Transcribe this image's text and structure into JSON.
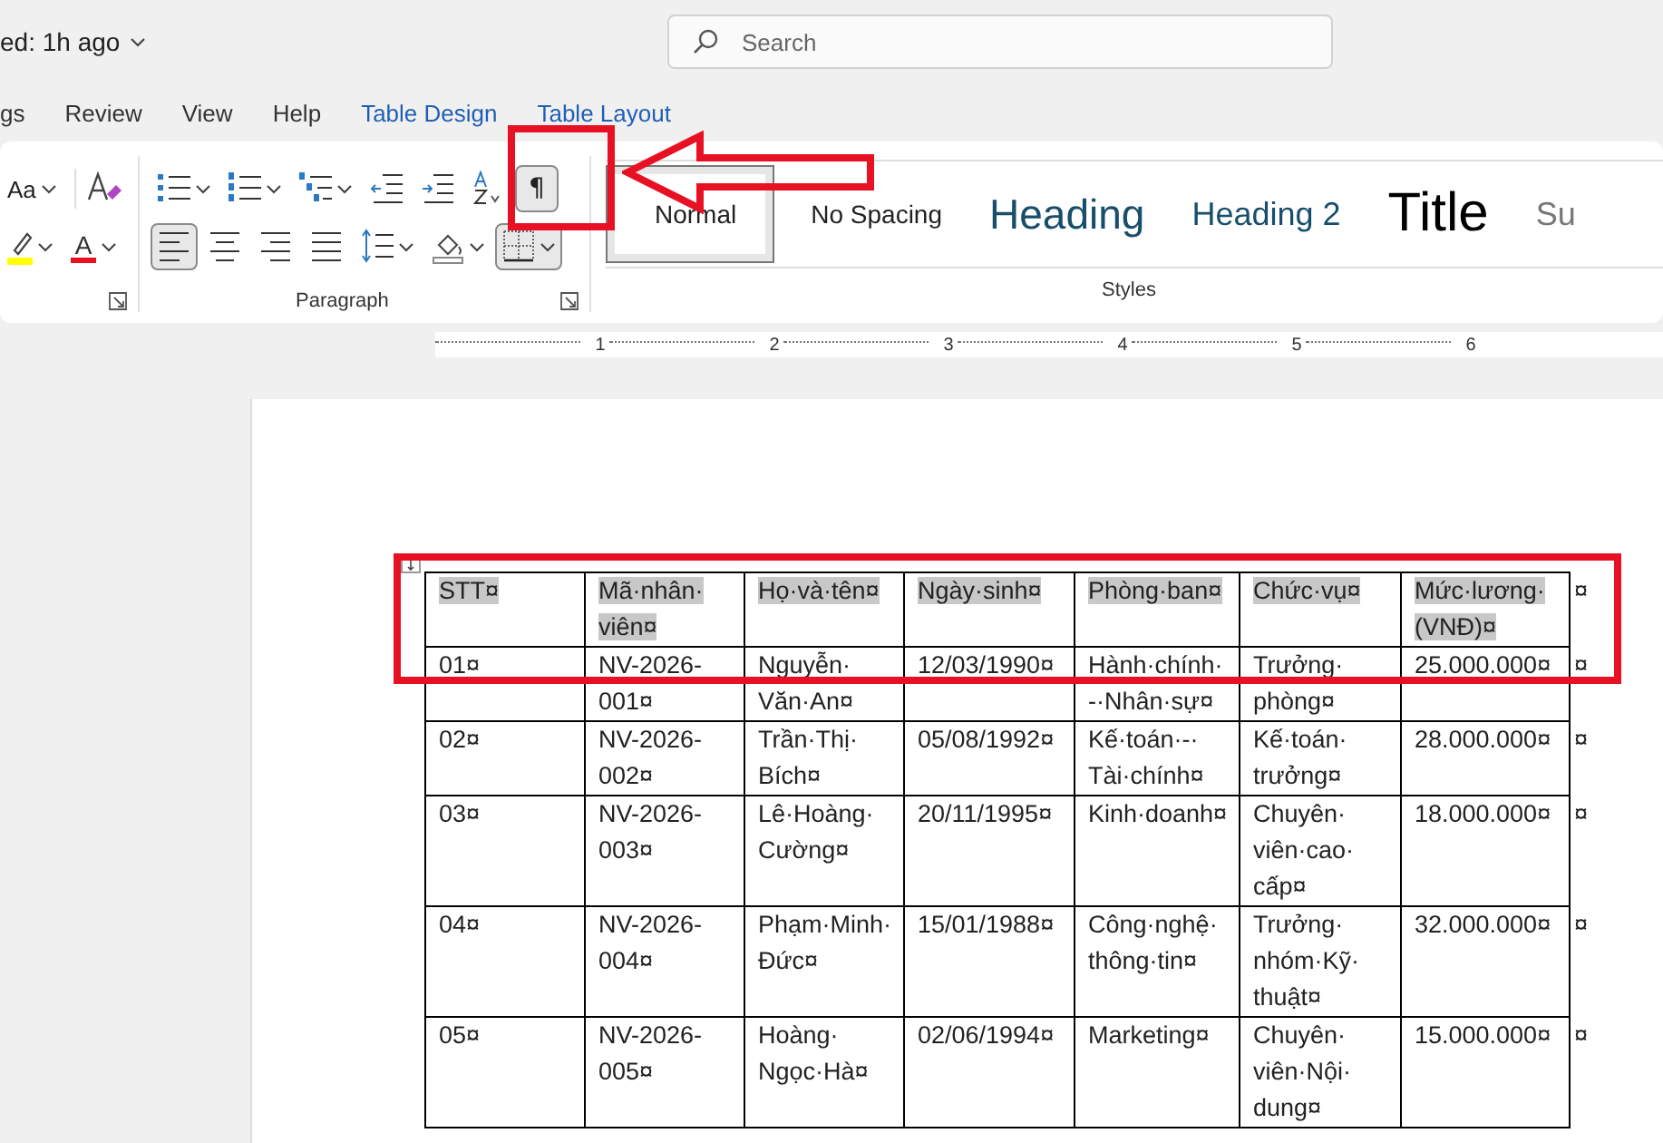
{
  "title_bar": {
    "saved_status": "ed: 1h ago",
    "search": {
      "placeholder": "Search"
    }
  },
  "tabs": [
    {
      "label": "gs",
      "kind": "standard"
    },
    {
      "label": "Review",
      "kind": "standard"
    },
    {
      "label": "View",
      "kind": "standard"
    },
    {
      "label": "Help",
      "kind": "standard"
    },
    {
      "label": "Table Design",
      "kind": "contextual"
    },
    {
      "label": "Table Layout",
      "kind": "contextual"
    }
  ],
  "font_group": {
    "change_case": {
      "label": "Aa"
    },
    "font_color_label": "A"
  },
  "paragraph_group": {
    "label": "Paragraph",
    "buttons": [
      {
        "pressed": false
      },
      {
        "pressed": false
      },
      {
        "pressed": false
      },
      {
        "pressed": false
      },
      {
        "pressed": false
      },
      {
        "pressed": false
      },
      {
        "pressed": true,
        "label": "¶"
      },
      {
        "pressed": true
      },
      {
        "pressed": false
      },
      {
        "pressed": false
      },
      {
        "pressed": false
      },
      {
        "pressed": false
      },
      {
        "pressed": false
      },
      {
        "pressed": true
      }
    ]
  },
  "styles_group": {
    "label": "Styles",
    "styles": [
      {
        "label": "Normal",
        "kind": "normal",
        "selected": true
      },
      {
        "label": "No Spacing",
        "kind": "no_spacing",
        "selected": false
      },
      {
        "label": "Heading",
        "kind": "heading1",
        "selected": false
      },
      {
        "label": "Heading 2",
        "kind": "heading2",
        "selected": false
      },
      {
        "label": "Title",
        "kind": "title",
        "selected": false
      },
      {
        "label": "Su",
        "kind": "subtitle",
        "selected": false
      }
    ]
  },
  "ruler": {
    "numbers": [
      "1",
      "2",
      "3",
      "4",
      "5",
      "6"
    ]
  },
  "table": {
    "columns": [
      "STT¤",
      "Mã·nhân·viên¤",
      "Họ·và·tên¤",
      "Ngày·sinh¤",
      "Phòng·ban¤",
      "Chức·vụ¤",
      "Mức·lương·(VNĐ)¤"
    ],
    "header_end_mark": "¤",
    "rows": [
      {
        "cells": [
          "01¤",
          "NV-2026-001¤",
          "Nguyễn·Văn·An¤",
          "12/03/1990¤",
          "Hành·chính·-·Nhân·sự¤",
          "Trưởng·phòng¤",
          "25.000.000¤"
        ],
        "end_mark": "¤"
      },
      {
        "cells": [
          "02¤",
          "NV-2026-002¤",
          "Trần·Thị·Bích¤",
          "05/08/1992¤",
          "Kế·toán·-·Tài·chính¤",
          "Kế·toán·trưởng¤",
          "28.000.000¤"
        ],
        "end_mark": "¤"
      },
      {
        "cells": [
          "03¤",
          "NV-2026-003¤",
          "Lê·Hoàng·Cường¤",
          "20/11/1995¤",
          "Kinh·doanh¤",
          "Chuyên·viên·cao·cấp¤",
          "18.000.000¤"
        ],
        "end_mark": "¤"
      },
      {
        "cells": [
          "04¤",
          "NV-2026-004¤",
          "Phạm·Minh·Đức¤",
          "15/01/1988¤",
          "Công·nghệ·thông·tin¤",
          "Trưởng·nhóm·Kỹ·thuật¤",
          "32.000.000¤"
        ],
        "end_mark": "¤"
      },
      {
        "cells": [
          "05¤",
          "NV-2026-005¤",
          "Hoàng·Ngọc·Hà¤",
          "02/06/1994¤",
          "Marketing¤",
          "Chuyên·viên·Nội·dung¤",
          "15.000.000¤"
        ],
        "end_mark": "¤"
      }
    ]
  }
}
